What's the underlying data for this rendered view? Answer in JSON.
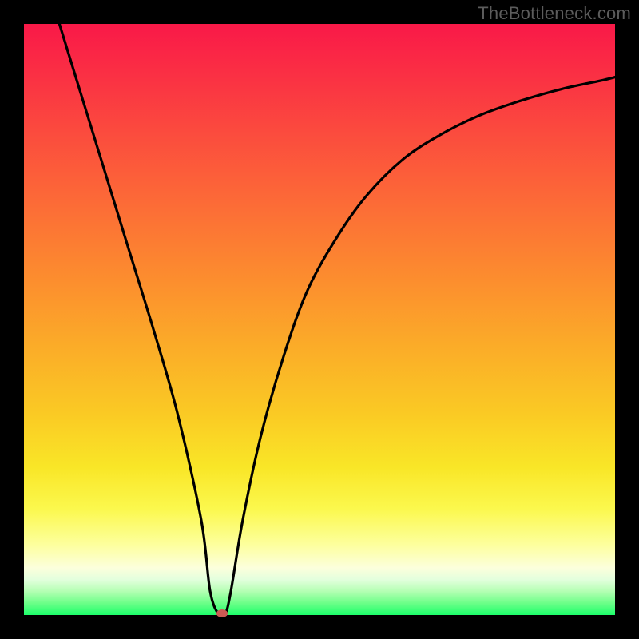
{
  "watermark": "TheBottleneck.com",
  "colors": {
    "frame": "#000000",
    "gradient_top": "#f91948",
    "gradient_bottom": "#1dff6b",
    "curve": "#000000",
    "marker": "#cc5a54"
  },
  "chart_data": {
    "type": "line",
    "title": "",
    "xlabel": "",
    "ylabel": "",
    "xlim": [
      0,
      100
    ],
    "ylim": [
      0,
      100
    ],
    "annotations": [],
    "series": [
      {
        "name": "bottleneck-curve",
        "x": [
          6,
          10,
          14,
          18,
          22,
          26,
          30,
          31.5,
          33,
          34,
          35,
          37,
          40,
          44,
          48,
          53,
          58,
          64,
          70,
          77,
          84,
          91,
          98,
          100
        ],
        "y": [
          100,
          87,
          74,
          61,
          48,
          34,
          16,
          4,
          0,
          0,
          4,
          16,
          30,
          44,
          55,
          64,
          71,
          77,
          81,
          84.5,
          87,
          89,
          90.5,
          91
        ]
      }
    ],
    "marker": {
      "x": 33.5,
      "y": 0.3
    },
    "grid": false,
    "legend": false
  }
}
